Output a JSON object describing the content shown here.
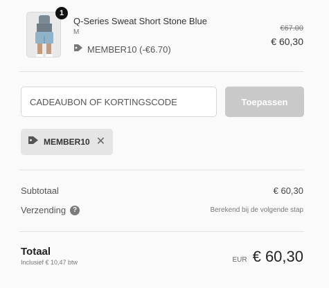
{
  "product": {
    "quantity": "1",
    "title": "Q-Series Sweat Short Stone Blue",
    "variant": "M",
    "discount_label": "MEMBER10 (-€6.70)",
    "price_original": "€67.00",
    "price_current": "€ 60,30",
    "discount_icon": "tag-icon"
  },
  "discount_form": {
    "placeholder": "CADEAUBON OF KORTINGSCODE",
    "value": "",
    "apply_label": "Toepassen"
  },
  "applied_codes": [
    {
      "code": "MEMBER10",
      "icon": "tag-icon",
      "remove_icon": "close-icon"
    }
  ],
  "summary": {
    "subtotal_label": "Subtotaal",
    "subtotal_value": "€ 60,30",
    "shipping_label": "Verzending",
    "shipping_value": "Berekend bij de volgende stap",
    "help_icon": "?",
    "total_label": "Totaal",
    "tax_note": "Inclusief € 10,47 btw",
    "currency": "EUR",
    "total_value": "€ 60,30"
  },
  "colors": {
    "background": "#fafafa",
    "apply_button_disabled": "#c9c9c9",
    "chip_background": "#e5e5e5",
    "badge": "#111111"
  }
}
